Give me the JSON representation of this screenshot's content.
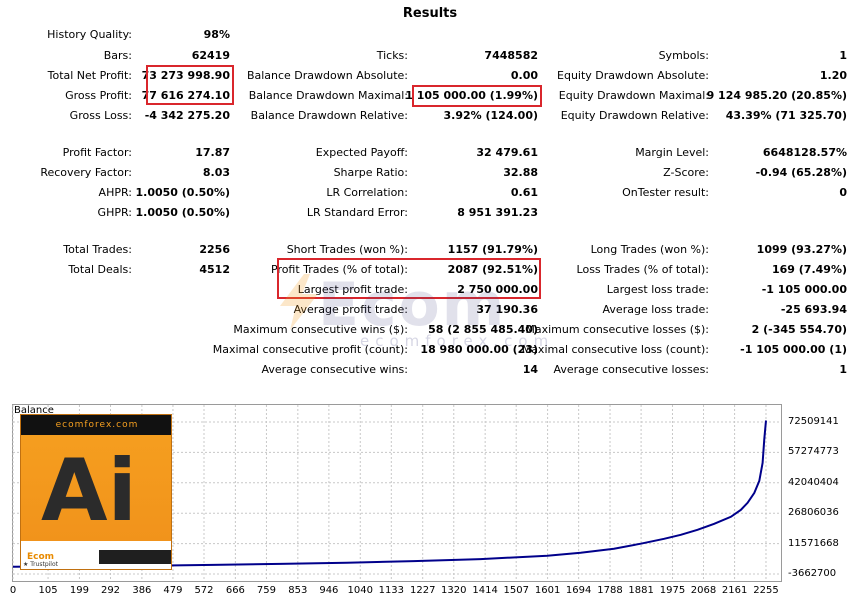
{
  "title": "Results",
  "stats": {
    "history_quality": {
      "label": "History Quality:",
      "value": "98%"
    },
    "bars": {
      "label": "Bars:",
      "value": "62419"
    },
    "ticks": {
      "label": "Ticks:",
      "value": "7448582"
    },
    "symbols": {
      "label": "Symbols:",
      "value": "1"
    },
    "total_net_profit": {
      "label": "Total Net Profit:",
      "value": "73 273 998.90"
    },
    "balance_dd_abs": {
      "label": "Balance Drawdown Absolute:",
      "value": "0.00"
    },
    "equity_dd_abs": {
      "label": "Equity Drawdown Absolute:",
      "value": "1.20"
    },
    "gross_profit": {
      "label": "Gross Profit:",
      "value": "77 616 274.10"
    },
    "balance_dd_max": {
      "label": "Balance Drawdown Maximal:",
      "value": "1 105 000.00 (1.99%)"
    },
    "equity_dd_max": {
      "label": "Equity Drawdown Maximal:",
      "value": "9 124 985.20 (20.85%)"
    },
    "gross_loss": {
      "label": "Gross Loss:",
      "value": "-4 342 275.20"
    },
    "balance_dd_rel": {
      "label": "Balance Drawdown Relative:",
      "value": "3.92% (124.00)"
    },
    "equity_dd_rel": {
      "label": "Equity Drawdown Relative:",
      "value": "43.39% (71 325.70)"
    },
    "profit_factor": {
      "label": "Profit Factor:",
      "value": "17.87"
    },
    "expected_payoff": {
      "label": "Expected Payoff:",
      "value": "32 479.61"
    },
    "margin_level": {
      "label": "Margin Level:",
      "value": "6648128.57%"
    },
    "recovery_factor": {
      "label": "Recovery Factor:",
      "value": "8.03"
    },
    "sharpe_ratio": {
      "label": "Sharpe Ratio:",
      "value": "32.88"
    },
    "z_score": {
      "label": "Z-Score:",
      "value": "-0.94 (65.28%)"
    },
    "ahpr": {
      "label": "AHPR:",
      "value": "1.0050 (0.50%)"
    },
    "lr_correlation": {
      "label": "LR Correlation:",
      "value": "0.61"
    },
    "ontester": {
      "label": "OnTester result:",
      "value": "0"
    },
    "ghpr": {
      "label": "GHPR:",
      "value": "1.0050 (0.50%)"
    },
    "lr_std_error": {
      "label": "LR Standard Error:",
      "value": "8 951 391.23"
    },
    "total_trades": {
      "label": "Total Trades:",
      "value": "2256"
    },
    "short_trades": {
      "label": "Short Trades (won %):",
      "value": "1157 (91.79%)"
    },
    "long_trades": {
      "label": "Long Trades (won %):",
      "value": "1099 (93.27%)"
    },
    "total_deals": {
      "label": "Total Deals:",
      "value": "4512"
    },
    "profit_trades": {
      "label": "Profit Trades (% of total):",
      "value": "2087 (92.51%)"
    },
    "loss_trades": {
      "label": "Loss Trades (% of total):",
      "value": "169 (7.49%)"
    },
    "largest_profit": {
      "label": "Largest profit trade:",
      "value": "2 750 000.00"
    },
    "largest_loss": {
      "label": "Largest loss trade:",
      "value": "-1 105 000.00"
    },
    "avg_profit": {
      "label": "Average profit trade:",
      "value": "37 190.36"
    },
    "avg_loss": {
      "label": "Average loss trade:",
      "value": "-25 693.94"
    },
    "max_consec_wins": {
      "label": "Maximum consecutive wins ($):",
      "value": "58 (2 855 485.40)"
    },
    "max_consec_losses": {
      "label": "Maximum consecutive losses ($):",
      "value": "2 (-345 554.70)"
    },
    "maximal_consec_profit": {
      "label": "Maximal consecutive profit (count):",
      "value": "18 980 000.00 (23)"
    },
    "maximal_consec_loss": {
      "label": "Maximal consecutive loss (count):",
      "value": "-1 105 000.00 (1)"
    },
    "avg_consec_wins": {
      "label": "Average consecutive wins:",
      "value": "14"
    },
    "avg_consec_losses": {
      "label": "Average consecutive losses:",
      "value": "1"
    }
  },
  "watermark": {
    "big": "Ecom",
    "small": "ecomforex.com"
  },
  "ad": {
    "top": "ecomforex.com",
    "big": "Ai",
    "logo": "Ecom",
    "trust": "★ Trustpilot"
  },
  "chart_data": {
    "type": "line",
    "title": "Balance",
    "x_ticks": [
      "0",
      "105",
      "199",
      "292",
      "386",
      "479",
      "572",
      "666",
      "759",
      "853",
      "946",
      "1040",
      "1133",
      "1227",
      "1320",
      "1414",
      "1507",
      "1601",
      "1694",
      "1788",
      "1881",
      "1975",
      "2068",
      "2161",
      "2255"
    ],
    "y_ticks": [
      "72509141",
      "57274773",
      "42040404",
      "26806036",
      "11571668",
      "-3662700"
    ],
    "ylim": [
      -3662700,
      72509141
    ],
    "xlim": [
      0,
      2300
    ],
    "series": [
      {
        "color": "#00008b",
        "x": [
          0,
          200,
          400,
          600,
          800,
          1000,
          1200,
          1400,
          1600,
          1700,
          1800,
          1880,
          1950,
          2000,
          2050,
          2100,
          2150,
          2180,
          2200,
          2220,
          2235,
          2245,
          2250,
          2255
        ],
        "y": [
          0,
          200000,
          500000,
          900000,
          1400000,
          2000000,
          2800000,
          3800000,
          5500000,
          7000000,
          9000000,
          11500000,
          14000000,
          16000000,
          18500000,
          21500000,
          25000000,
          28500000,
          32000000,
          37000000,
          43000000,
          52000000,
          64000000,
          73273998
        ]
      }
    ],
    "grid": true
  }
}
